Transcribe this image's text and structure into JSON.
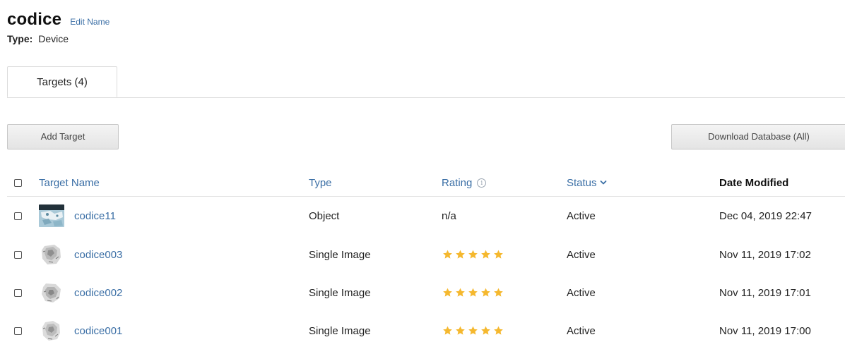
{
  "database": {
    "name": "codice",
    "edit_label": "Edit Name",
    "type_label": "Type:",
    "type_value": "Device"
  },
  "tabs": [
    {
      "label": "Targets (4)",
      "active": true
    }
  ],
  "toolbar": {
    "add_label": "Add Target",
    "download_label": "Download Database (All)"
  },
  "table": {
    "columns": {
      "name": "Target Name",
      "type": "Type",
      "rating": "Rating",
      "status": "Status",
      "date": "Date Modified"
    },
    "rows": [
      {
        "name": "codice11",
        "type": "Object",
        "rating_text": "n/a",
        "rating_stars": 0,
        "status": "Active",
        "date": "Dec 04, 2019 22:47",
        "thumb": "object-thumb-icon"
      },
      {
        "name": "codice003",
        "type": "Single Image",
        "rating_text": "",
        "rating_stars": 5,
        "status": "Active",
        "date": "Nov 11, 2019 17:02",
        "thumb": "image-thumb-icon"
      },
      {
        "name": "codice002",
        "type": "Single Image",
        "rating_text": "",
        "rating_stars": 5,
        "status": "Active",
        "date": "Nov 11, 2019 17:01",
        "thumb": "image-thumb-icon"
      },
      {
        "name": "codice001",
        "type": "Single Image",
        "rating_text": "",
        "rating_stars": 5,
        "status": "Active",
        "date": "Nov 11, 2019 17:00",
        "thumb": "image-thumb-icon"
      }
    ]
  },
  "colors": {
    "link": "#3a6ea5",
    "star": "#f5b82e"
  }
}
